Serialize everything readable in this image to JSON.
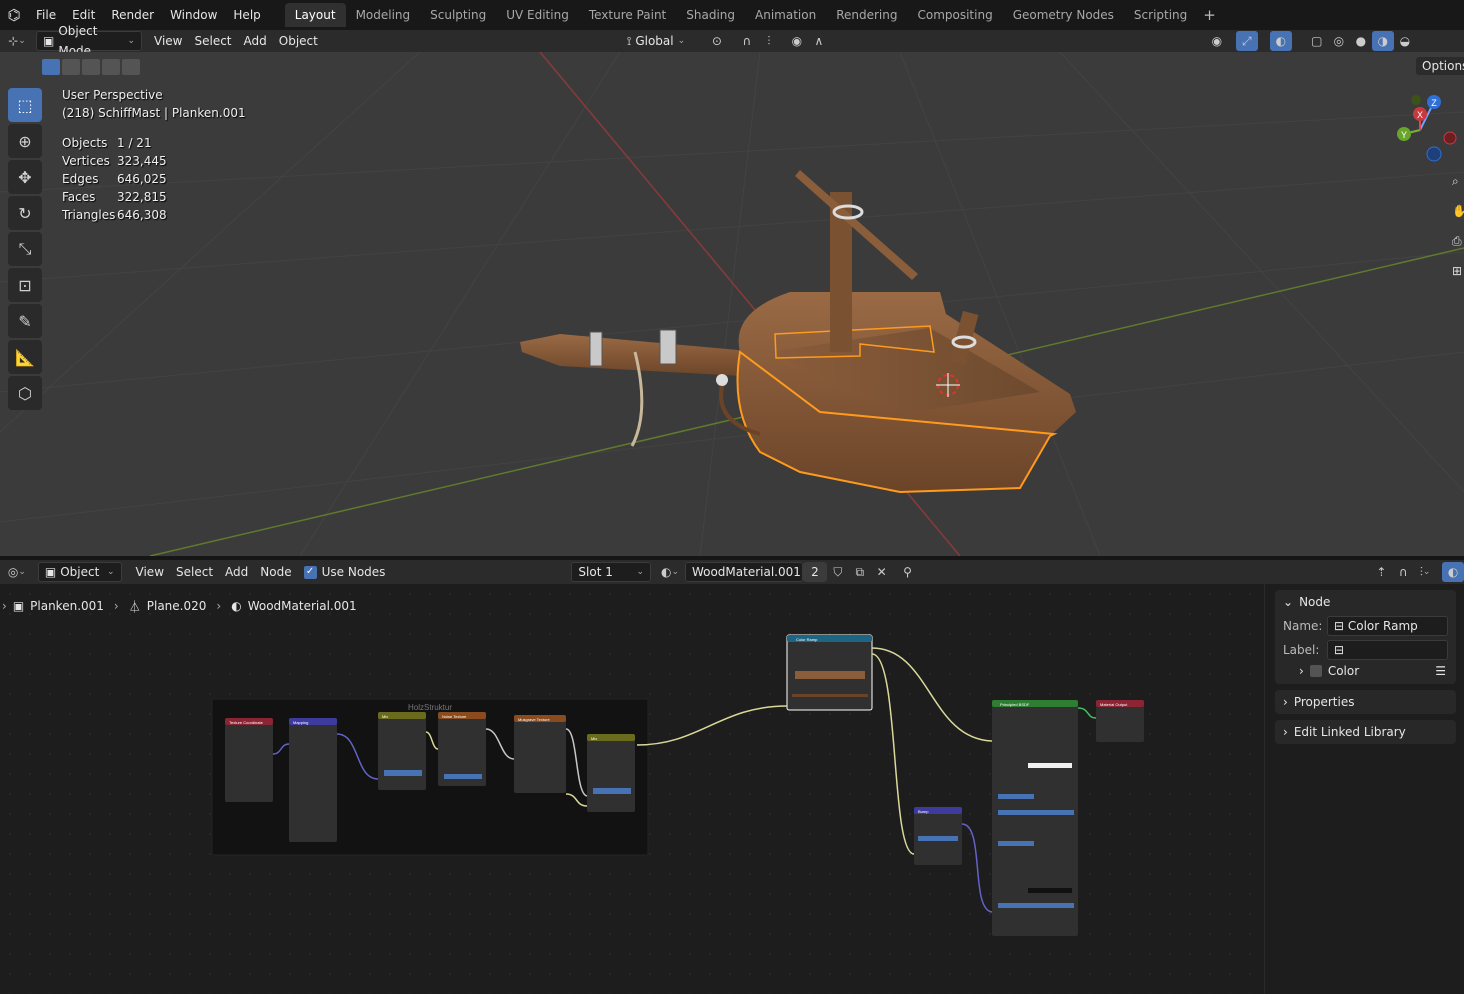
{
  "topbar": {
    "menus": [
      "File",
      "Edit",
      "Render",
      "Window",
      "Help"
    ],
    "workspaces": [
      "Layout",
      "Modeling",
      "Sculpting",
      "UV Editing",
      "Texture Paint",
      "Shading",
      "Animation",
      "Rendering",
      "Compositing",
      "Geometry Nodes",
      "Scripting"
    ],
    "active_workspace": "Layout"
  },
  "viewport_header": {
    "mode": "Object Mode",
    "menus": [
      "View",
      "Select",
      "Add",
      "Object"
    ],
    "transform_orientation": "Global"
  },
  "viewport": {
    "perspective": "User Perspective",
    "object_info": "(218) SchiffMast | Planken.001",
    "stats": [
      {
        "label": "Objects",
        "value": "1 / 21"
      },
      {
        "label": "Vertices",
        "value": "323,445"
      },
      {
        "label": "Edges",
        "value": "646,025"
      },
      {
        "label": "Faces",
        "value": "322,815"
      },
      {
        "label": "Triangles",
        "value": "646,308"
      }
    ],
    "options_label": "Options",
    "gizmo": {
      "x": "X",
      "y": "Y",
      "z": "Z"
    }
  },
  "node_header": {
    "editor_type": "Object",
    "menus": [
      "View",
      "Select",
      "Add",
      "Node"
    ],
    "use_nodes_label": "Use Nodes",
    "slot": "Slot 1",
    "material_name": "WoodMaterial.001",
    "users": "2"
  },
  "breadcrumb": [
    "Planken.001",
    "Plane.020",
    "WoodMaterial.001"
  ],
  "side_panel": {
    "node_section": "Node",
    "name_label": "Name:",
    "name_value": "Color Ramp",
    "label_label": "Label:",
    "label_value": "",
    "color_label": "Color",
    "properties_section": "Properties",
    "linked_library_section": "Edit Linked Library"
  },
  "nodes": {
    "frame_label": "HolzStruktur",
    "texcoord": "Texture Coordinate",
    "mapping": "Mapping",
    "mix1": "Mix",
    "noise": "Noise Texture",
    "musgrave": "Musgrave Texture",
    "mix2": "Mix",
    "colorramp": "Color Ramp",
    "bump": "Bump",
    "bsdf": "Principled BSDF",
    "output": "Material Output"
  }
}
